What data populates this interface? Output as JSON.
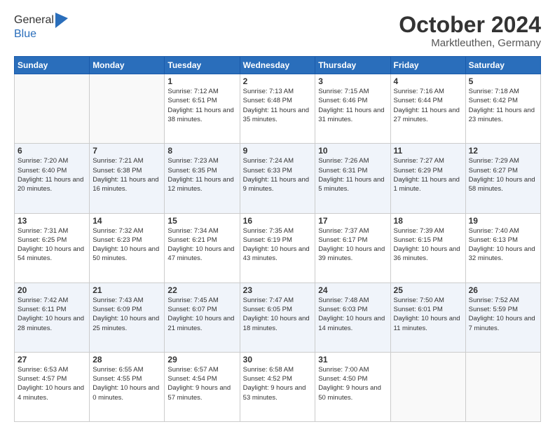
{
  "logo": {
    "general": "General",
    "blue": "Blue"
  },
  "header": {
    "month": "October 2024",
    "location": "Marktleuthen, Germany"
  },
  "weekdays": [
    "Sunday",
    "Monday",
    "Tuesday",
    "Wednesday",
    "Thursday",
    "Friday",
    "Saturday"
  ],
  "weeks": [
    [
      {
        "day": "",
        "info": ""
      },
      {
        "day": "",
        "info": ""
      },
      {
        "day": "1",
        "info": "Sunrise: 7:12 AM\nSunset: 6:51 PM\nDaylight: 11 hours and 38 minutes."
      },
      {
        "day": "2",
        "info": "Sunrise: 7:13 AM\nSunset: 6:48 PM\nDaylight: 11 hours and 35 minutes."
      },
      {
        "day": "3",
        "info": "Sunrise: 7:15 AM\nSunset: 6:46 PM\nDaylight: 11 hours and 31 minutes."
      },
      {
        "day": "4",
        "info": "Sunrise: 7:16 AM\nSunset: 6:44 PM\nDaylight: 11 hours and 27 minutes."
      },
      {
        "day": "5",
        "info": "Sunrise: 7:18 AM\nSunset: 6:42 PM\nDaylight: 11 hours and 23 minutes."
      }
    ],
    [
      {
        "day": "6",
        "info": "Sunrise: 7:20 AM\nSunset: 6:40 PM\nDaylight: 11 hours and 20 minutes."
      },
      {
        "day": "7",
        "info": "Sunrise: 7:21 AM\nSunset: 6:38 PM\nDaylight: 11 hours and 16 minutes."
      },
      {
        "day": "8",
        "info": "Sunrise: 7:23 AM\nSunset: 6:35 PM\nDaylight: 11 hours and 12 minutes."
      },
      {
        "day": "9",
        "info": "Sunrise: 7:24 AM\nSunset: 6:33 PM\nDaylight: 11 hours and 9 minutes."
      },
      {
        "day": "10",
        "info": "Sunrise: 7:26 AM\nSunset: 6:31 PM\nDaylight: 11 hours and 5 minutes."
      },
      {
        "day": "11",
        "info": "Sunrise: 7:27 AM\nSunset: 6:29 PM\nDaylight: 11 hours and 1 minute."
      },
      {
        "day": "12",
        "info": "Sunrise: 7:29 AM\nSunset: 6:27 PM\nDaylight: 10 hours and 58 minutes."
      }
    ],
    [
      {
        "day": "13",
        "info": "Sunrise: 7:31 AM\nSunset: 6:25 PM\nDaylight: 10 hours and 54 minutes."
      },
      {
        "day": "14",
        "info": "Sunrise: 7:32 AM\nSunset: 6:23 PM\nDaylight: 10 hours and 50 minutes."
      },
      {
        "day": "15",
        "info": "Sunrise: 7:34 AM\nSunset: 6:21 PM\nDaylight: 10 hours and 47 minutes."
      },
      {
        "day": "16",
        "info": "Sunrise: 7:35 AM\nSunset: 6:19 PM\nDaylight: 10 hours and 43 minutes."
      },
      {
        "day": "17",
        "info": "Sunrise: 7:37 AM\nSunset: 6:17 PM\nDaylight: 10 hours and 39 minutes."
      },
      {
        "day": "18",
        "info": "Sunrise: 7:39 AM\nSunset: 6:15 PM\nDaylight: 10 hours and 36 minutes."
      },
      {
        "day": "19",
        "info": "Sunrise: 7:40 AM\nSunset: 6:13 PM\nDaylight: 10 hours and 32 minutes."
      }
    ],
    [
      {
        "day": "20",
        "info": "Sunrise: 7:42 AM\nSunset: 6:11 PM\nDaylight: 10 hours and 28 minutes."
      },
      {
        "day": "21",
        "info": "Sunrise: 7:43 AM\nSunset: 6:09 PM\nDaylight: 10 hours and 25 minutes."
      },
      {
        "day": "22",
        "info": "Sunrise: 7:45 AM\nSunset: 6:07 PM\nDaylight: 10 hours and 21 minutes."
      },
      {
        "day": "23",
        "info": "Sunrise: 7:47 AM\nSunset: 6:05 PM\nDaylight: 10 hours and 18 minutes."
      },
      {
        "day": "24",
        "info": "Sunrise: 7:48 AM\nSunset: 6:03 PM\nDaylight: 10 hours and 14 minutes."
      },
      {
        "day": "25",
        "info": "Sunrise: 7:50 AM\nSunset: 6:01 PM\nDaylight: 10 hours and 11 minutes."
      },
      {
        "day": "26",
        "info": "Sunrise: 7:52 AM\nSunset: 5:59 PM\nDaylight: 10 hours and 7 minutes."
      }
    ],
    [
      {
        "day": "27",
        "info": "Sunrise: 6:53 AM\nSunset: 4:57 PM\nDaylight: 10 hours and 4 minutes."
      },
      {
        "day": "28",
        "info": "Sunrise: 6:55 AM\nSunset: 4:55 PM\nDaylight: 10 hours and 0 minutes."
      },
      {
        "day": "29",
        "info": "Sunrise: 6:57 AM\nSunset: 4:54 PM\nDaylight: 9 hours and 57 minutes."
      },
      {
        "day": "30",
        "info": "Sunrise: 6:58 AM\nSunset: 4:52 PM\nDaylight: 9 hours and 53 minutes."
      },
      {
        "day": "31",
        "info": "Sunrise: 7:00 AM\nSunset: 4:50 PM\nDaylight: 9 hours and 50 minutes."
      },
      {
        "day": "",
        "info": ""
      },
      {
        "day": "",
        "info": ""
      }
    ]
  ]
}
